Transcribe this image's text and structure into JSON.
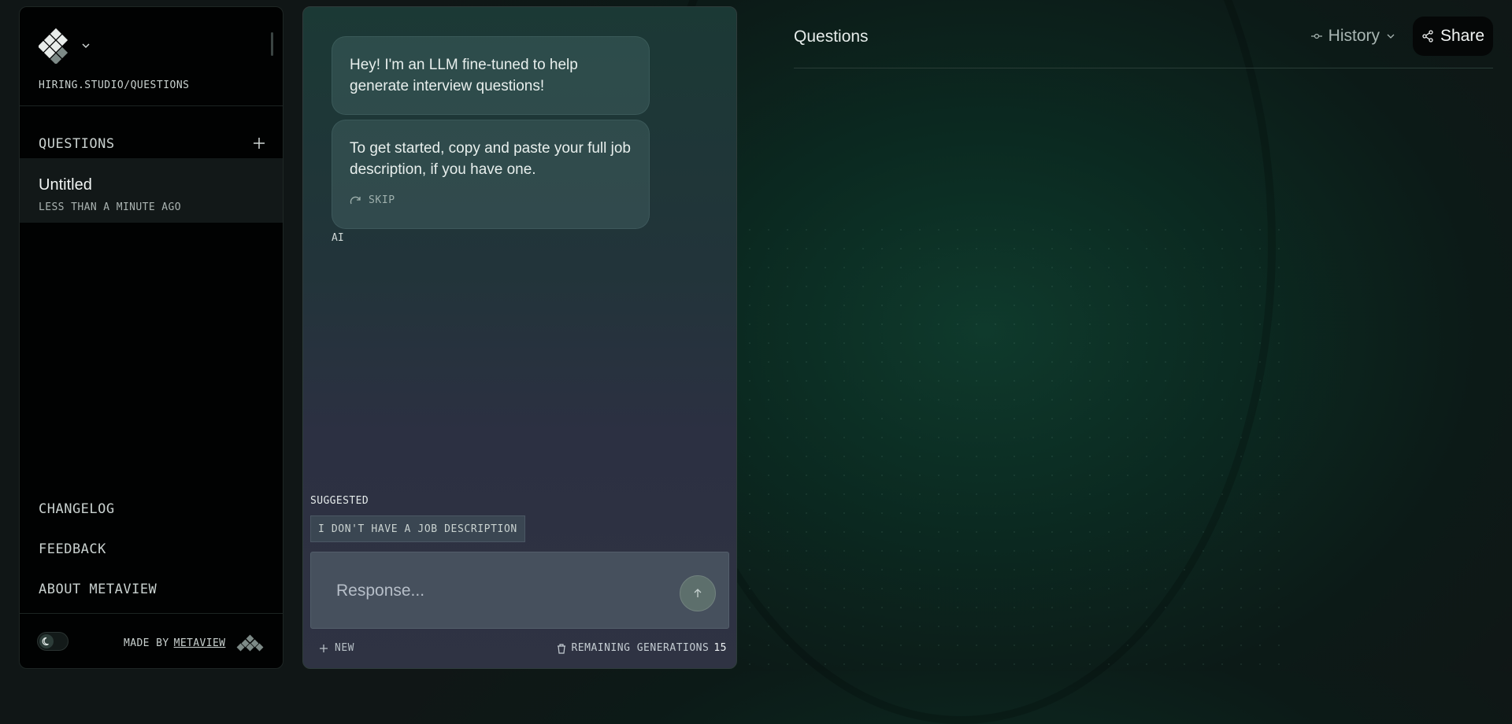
{
  "sidebar": {
    "url": "HIRING.STUDIO/QUESTIONS",
    "section_title": "QUESTIONS",
    "items": [
      {
        "title": "Untitled",
        "subtitle": "LESS THAN A MINUTE AGO"
      }
    ],
    "nav": [
      "CHANGELOG",
      "FEEDBACK",
      "ABOUT METAVIEW"
    ],
    "made_by_label": "MADE BY",
    "made_by_link": "METAVIEW"
  },
  "chat": {
    "messages": [
      "Hey! I'm an LLM fine-tuned to help generate interview questions!",
      "To get started, copy and paste your full job description, if you have one."
    ],
    "skip_label": "SKIP",
    "sender_label": "AI",
    "suggested_label": "SUGGESTED",
    "suggestion": "I DON'T HAVE A JOB DESCRIPTION",
    "input_placeholder": "Response...",
    "new_label": "NEW",
    "remaining_label": "REMAINING GENERATIONS",
    "remaining_count": "15"
  },
  "header": {
    "title": "Questions",
    "history_label": "History",
    "share_label": "Share"
  },
  "icons": {
    "logo": "diamond-grid-logo-icon",
    "toggle": "moon-icon",
    "send": "arrow-up-icon",
    "history": "commit-icon",
    "share": "share-nodes-icon"
  }
}
